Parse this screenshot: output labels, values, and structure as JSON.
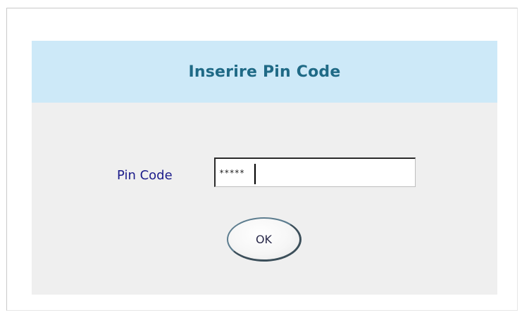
{
  "dialog": {
    "title": "Inserire Pin Code",
    "pin_label": "Pin Code",
    "pin_value": "*****",
    "ok_label": "OK"
  },
  "colors": {
    "header_bg": "#cde9f8",
    "title_text": "#1f6a86",
    "panel_bg": "#efefef",
    "label_text": "#1b1b8a"
  }
}
